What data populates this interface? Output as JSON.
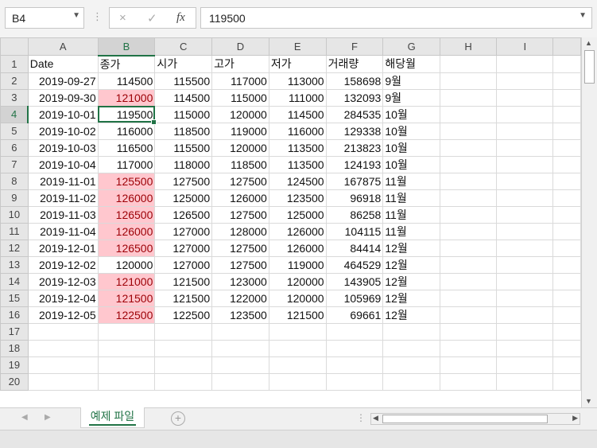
{
  "namebox": {
    "value": "B4"
  },
  "formula": {
    "cancel_icon": "×",
    "enter_icon": "✓",
    "fx_label": "fx",
    "value": "119500"
  },
  "columns": [
    "A",
    "B",
    "C",
    "D",
    "E",
    "F",
    "G",
    "H",
    "I"
  ],
  "headers": [
    "Date",
    "종가",
    "시가",
    "고가",
    "저가",
    "거래량",
    "해당월"
  ],
  "rows": [
    {
      "n": "2",
      "date": "2019-09-27",
      "close": "114500",
      "open": "115500",
      "high": "117000",
      "low": "113000",
      "vol": "158698",
      "month": "9월",
      "hl": false
    },
    {
      "n": "3",
      "date": "2019-09-30",
      "close": "121000",
      "open": "114500",
      "high": "115000",
      "low": "111000",
      "vol": "132093",
      "month": "9월",
      "hl": true
    },
    {
      "n": "4",
      "date": "2019-10-01",
      "close": "119500",
      "open": "115000",
      "high": "120000",
      "low": "114500",
      "vol": "284535",
      "month": "10월",
      "hl": false
    },
    {
      "n": "5",
      "date": "2019-10-02",
      "close": "116000",
      "open": "118500",
      "high": "119000",
      "low": "116000",
      "vol": "129338",
      "month": "10월",
      "hl": false
    },
    {
      "n": "6",
      "date": "2019-10-03",
      "close": "116500",
      "open": "115500",
      "high": "120000",
      "low": "113500",
      "vol": "213823",
      "month": "10월",
      "hl": false
    },
    {
      "n": "7",
      "date": "2019-10-04",
      "close": "117000",
      "open": "118000",
      "high": "118500",
      "low": "113500",
      "vol": "124193",
      "month": "10월",
      "hl": false
    },
    {
      "n": "8",
      "date": "2019-11-01",
      "close": "125500",
      "open": "127500",
      "high": "127500",
      "low": "124500",
      "vol": "167875",
      "month": "11월",
      "hl": true
    },
    {
      "n": "9",
      "date": "2019-11-02",
      "close": "126000",
      "open": "125000",
      "high": "126000",
      "low": "123500",
      "vol": "96918",
      "month": "11월",
      "hl": true
    },
    {
      "n": "10",
      "date": "2019-11-03",
      "close": "126500",
      "open": "126500",
      "high": "127500",
      "low": "125000",
      "vol": "86258",
      "month": "11월",
      "hl": true
    },
    {
      "n": "11",
      "date": "2019-11-04",
      "close": "126000",
      "open": "127000",
      "high": "128000",
      "low": "126000",
      "vol": "104115",
      "month": "11월",
      "hl": true
    },
    {
      "n": "12",
      "date": "2019-12-01",
      "close": "126500",
      "open": "127000",
      "high": "127500",
      "low": "126000",
      "vol": "84414",
      "month": "12월",
      "hl": true
    },
    {
      "n": "13",
      "date": "2019-12-02",
      "close": "120000",
      "open": "127000",
      "high": "127500",
      "low": "119000",
      "vol": "464529",
      "month": "12월",
      "hl": false
    },
    {
      "n": "14",
      "date": "2019-12-03",
      "close": "121000",
      "open": "121500",
      "high": "123000",
      "low": "120000",
      "vol": "143905",
      "month": "12월",
      "hl": true
    },
    {
      "n": "15",
      "date": "2019-12-04",
      "close": "121500",
      "open": "121500",
      "high": "122000",
      "low": "120000",
      "vol": "105969",
      "month": "12월",
      "hl": true
    },
    {
      "n": "16",
      "date": "2019-12-05",
      "close": "122500",
      "open": "122500",
      "high": "123500",
      "low": "121500",
      "vol": "69661",
      "month": "12월",
      "hl": true
    }
  ],
  "empty_rows": [
    "17",
    "18",
    "19",
    "20"
  ],
  "active_row": "4",
  "sheet_tab": "예제 파일",
  "colors": {
    "accent": "#217346",
    "highlight_fill": "#ffc7ce",
    "highlight_text": "#9c0006"
  }
}
